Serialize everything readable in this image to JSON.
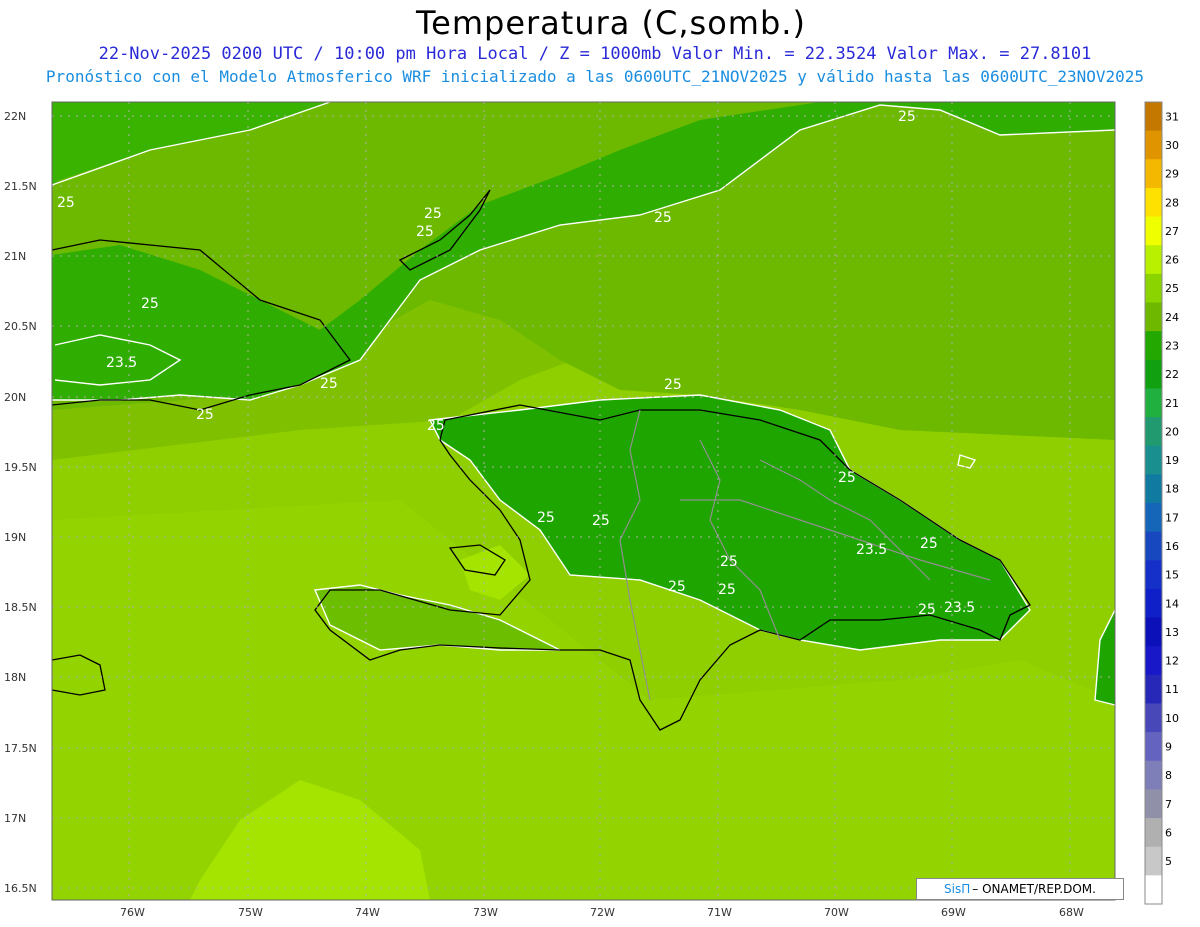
{
  "header": {
    "title": "Temperatura (C,somb.)",
    "line1": "22-Nov-2025 0200 UTC / 10:00 pm Hora Local / Z = 1000mb  Valor Min. = 22.3524  Valor Max. = 27.8101",
    "line2": "Pronóstico con el Modelo Atmosferico WRF inicializado a las 0600UTC_21NOV2025 y válido hasta las  0600UTC_23NOV2025"
  },
  "map": {
    "lat_labels": [
      "22N",
      "21.5N",
      "21N",
      "20.5N",
      "20N",
      "19.5N",
      "19N",
      "18.5N",
      "18N",
      "17.5N",
      "17N",
      "16.5N"
    ],
    "lon_labels": [
      "76W",
      "75W",
      "74W",
      "73W",
      "72W",
      "71W",
      "70W",
      "69W",
      "68W"
    ],
    "contour_labels": [
      "25",
      "25",
      "25",
      "25",
      "25",
      "23.5",
      "25",
      "25",
      "25",
      "25",
      "25",
      "25",
      "25",
      "25",
      "25",
      "25",
      "23.5",
      "25",
      "25",
      "23.5",
      "25"
    ],
    "colors": {
      "c21": "#6fbf00",
      "c22": "#33b000",
      "c23": "#129f00",
      "c24": "#52b400",
      "c25": "#80c000",
      "c26": "#93d400",
      "c27": "#a6e000"
    }
  },
  "colorbar": {
    "ticks": [
      "31",
      "30",
      "29",
      "28",
      "27",
      "26",
      "25",
      "24",
      "23",
      "22",
      "21",
      "20",
      "19",
      "18",
      "17",
      "16",
      "15",
      "14",
      "13",
      "12",
      "11",
      "10",
      "9",
      "8",
      "7",
      "6",
      "5"
    ],
    "colors": [
      "#c47800",
      "#e09400",
      "#f5b800",
      "#ffe100",
      "#f0ff00",
      "#b8f000",
      "#8cd400",
      "#6eb800",
      "#22a800",
      "#10a010",
      "#20b040",
      "#229a70",
      "#1a8f8f",
      "#107aa0",
      "#1565b8",
      "#1848c0",
      "#1530c8",
      "#1020c8",
      "#0c10b8",
      "#1818c8",
      "#2828b8",
      "#4848b8",
      "#6464c0",
      "#7e7eb8",
      "#9090a8",
      "#b0b0b0",
      "#c8c8c8",
      "#ffffff"
    ]
  },
  "credit": {
    "sis": "SisΠ",
    "org": "– ONAMET/REP.DOM."
  }
}
